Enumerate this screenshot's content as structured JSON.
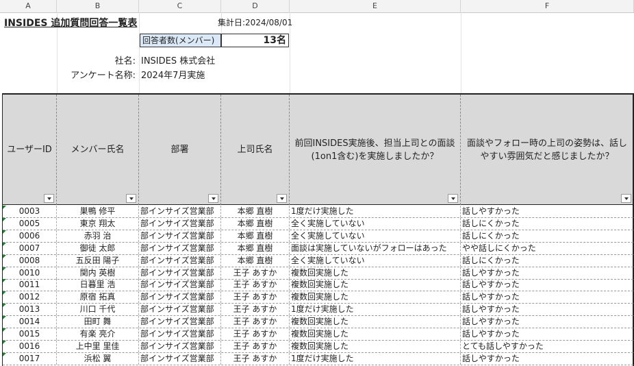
{
  "column_headers": [
    "A",
    "B",
    "C",
    "D",
    "E",
    "F"
  ],
  "title": "INSIDES 追加質問回答一覧表",
  "summary_date": "集計日:2024/08/01",
  "respondents": {
    "label": "回答者数(メンバー)",
    "value": "13名"
  },
  "company": {
    "label": "社名:",
    "value": "INSIDES 株式会社"
  },
  "survey": {
    "label": "アンケート名称:",
    "value": "2024年7月実施"
  },
  "table_headers": {
    "user_id": "ユーザーID",
    "member_name": "メンバー氏名",
    "dept": "部署",
    "boss_name": "上司氏名",
    "q1": "前回INSIDES実施後、担当上司との面談(1on1含む)を実施しましたか？",
    "q2": "面談やフォロー時の上司の姿勢は、話しやすい雰囲気だと感じましたか？"
  },
  "rows": [
    {
      "id": "0003",
      "name": "巣鴨 修平",
      "dept": "部インサイズ営業部",
      "boss": "本郷 直樹",
      "q1": "1度だけ実施した",
      "q2": "話しやすかった"
    },
    {
      "id": "0005",
      "name": "東京 翔太",
      "dept": "部インサイズ営業部",
      "boss": "本郷 直樹",
      "q1": "全く実施していない",
      "q2": "話しにくかった"
    },
    {
      "id": "0006",
      "name": "赤羽 治",
      "dept": "部インサイズ営業部",
      "boss": "本郷 直樹",
      "q1": "全く実施していない",
      "q2": "話しにくかった"
    },
    {
      "id": "0007",
      "name": "御徒 太郎",
      "dept": "部インサイズ営業部",
      "boss": "本郷 直樹",
      "q1": "面談は実施していないがフォローはあった",
      "q2": "やや話しにくかった"
    },
    {
      "id": "0008",
      "name": "五反田 陽子",
      "dept": "部インサイズ営業部",
      "boss": "本郷 直樹",
      "q1": "全く実施していない",
      "q2": "話しにくかった"
    },
    {
      "id": "0010",
      "name": "関内 英樹",
      "dept": "部インサイズ営業部",
      "boss": "王子 あすか",
      "q1": "複数回実施した",
      "q2": "話しやすかった"
    },
    {
      "id": "0011",
      "name": "日暮里 浩",
      "dept": "部インサイズ営業部",
      "boss": "王子 あすか",
      "q1": "複数回実施した",
      "q2": "話しやすかった"
    },
    {
      "id": "0012",
      "name": "原宿 拓真",
      "dept": "部インサイズ営業部",
      "boss": "王子 あすか",
      "q1": "複数回実施した",
      "q2": "話しやすかった"
    },
    {
      "id": "0013",
      "name": "川口 千代",
      "dept": "部インサイズ営業部",
      "boss": "王子 あすか",
      "q1": "1度だけ実施した",
      "q2": "話しやすかった"
    },
    {
      "id": "0014",
      "name": "田町 舞",
      "dept": "部インサイズ営業部",
      "boss": "王子 あすか",
      "q1": "複数回実施した",
      "q2": "話しやすかった"
    },
    {
      "id": "0015",
      "name": "有楽 亮介",
      "dept": "部インサイズ営業部",
      "boss": "王子 あすか",
      "q1": "複数回実施した",
      "q2": "話しやすかった"
    },
    {
      "id": "0016",
      "name": "上中里 里佳",
      "dept": "部インサイズ営業部",
      "boss": "王子 あすか",
      "q1": "複数回実施した",
      "q2": "とても話しやすかった"
    },
    {
      "id": "0017",
      "name": "浜松 翼",
      "dept": "部インサイズ営業部",
      "boss": "王子 あすか",
      "q1": "1度だけ実施した",
      "q2": "話しやすかった"
    }
  ]
}
